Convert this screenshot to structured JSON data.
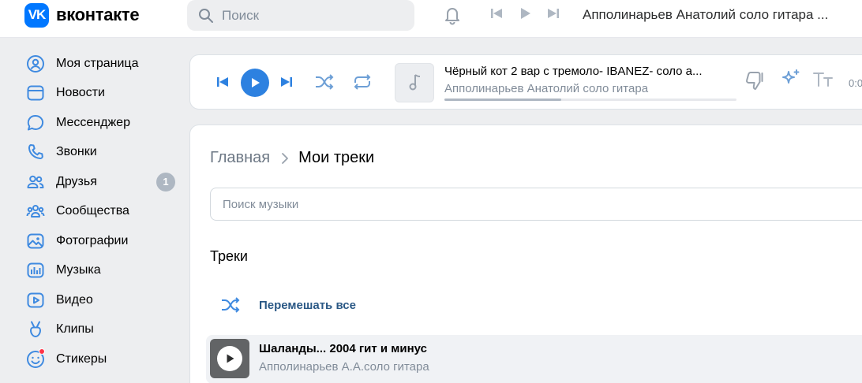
{
  "header": {
    "logo_letters": "VK",
    "logo_text": "вконтакте",
    "search_placeholder": "Поиск",
    "now_playing": "Апполинарьев Анатолий соло гитара ..."
  },
  "sidebar": {
    "items": [
      {
        "label": "Моя страница",
        "icon": "user-circle-icon"
      },
      {
        "label": "Новости",
        "icon": "news-icon"
      },
      {
        "label": "Мессенджер",
        "icon": "message-icon"
      },
      {
        "label": "Звонки",
        "icon": "phone-icon"
      },
      {
        "label": "Друзья",
        "icon": "friends-icon",
        "badge": "1"
      },
      {
        "label": "Сообщества",
        "icon": "communities-icon"
      },
      {
        "label": "Фотографии",
        "icon": "photo-icon"
      },
      {
        "label": "Музыка",
        "icon": "music-icon"
      },
      {
        "label": "Видео",
        "icon": "video-icon"
      },
      {
        "label": "Клипы",
        "icon": "clips-icon"
      },
      {
        "label": "Стикеры",
        "icon": "sticker-icon"
      }
    ]
  },
  "player": {
    "title": "Чёрный кот 2 вар с тремоло- IBANEZ- соло а...",
    "artist": "Апполинарьев Анатолий соло гитара",
    "time": "0:0",
    "progress": 0.4
  },
  "main": {
    "breadcrumb_home": "Главная",
    "breadcrumb_current": "Мои треки",
    "search_placeholder": "Поиск музыки",
    "section_title": "Треки",
    "shuffle_label": "Перемешать все",
    "tracks": [
      {
        "title": "Шаланды... 2004 гит и минус",
        "artist": "Апполинарьев А.А.соло гитара"
      }
    ]
  },
  "colors": {
    "accent": "#2d81e0",
    "brand": "#0077ff",
    "icon": "#3f8ae0",
    "link": "#2a5885",
    "badge": "#aeb7c2",
    "notification": "#ff3347"
  }
}
